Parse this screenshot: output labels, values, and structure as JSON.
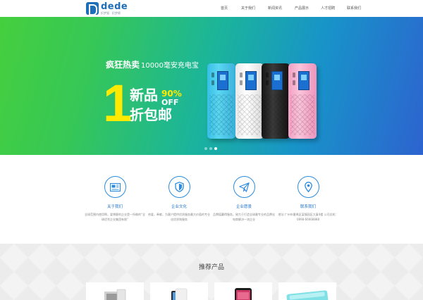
{
  "header": {
    "logo_word": "dede",
    "logo_sub": "织梦猫 · 织梦模",
    "nav": [
      "首页",
      "关于我们",
      "新闻资讯",
      "产品展示",
      "人才招聘",
      "联系我们"
    ]
  },
  "banner": {
    "headline": "疯狂热卖",
    "capacity": "10000毫安充电宝",
    "big_number": "1",
    "promo_line1": "新品",
    "promo_line2": "折包邮",
    "off_percent": "90%",
    "off_word": "OFF",
    "slides_total": 3,
    "slides_active": 3
  },
  "features": [
    {
      "icon": "newspaper-icon",
      "title": "关于我们",
      "desc": "全球范围内使用啊，爱博客的企业是一所做的“全球优秀企业集团有限”"
    },
    {
      "icon": "shield-icon",
      "title": "企业文化",
      "desc": "热爱，奉献，为客户提供优质服务最大价值的专业化优质和服务"
    },
    {
      "icon": "paper-plane-icon",
      "title": "企业愿景",
      "desc": "品牌值赢得服务，致力于打造全球最专业的品牌化电商解决一流企业"
    },
    {
      "icon": "map-pin-icon",
      "title": "联系我们",
      "desc": "地址:广州市番禺区某镇园区大厦4楼 公司总机：0898-66668888"
    }
  ],
  "products": {
    "title": "推荐产品"
  },
  "colors": {
    "brand_blue": "#1e6fb8",
    "accent_yellow": "#ffea00",
    "icon_blue": "#2a8be0"
  }
}
